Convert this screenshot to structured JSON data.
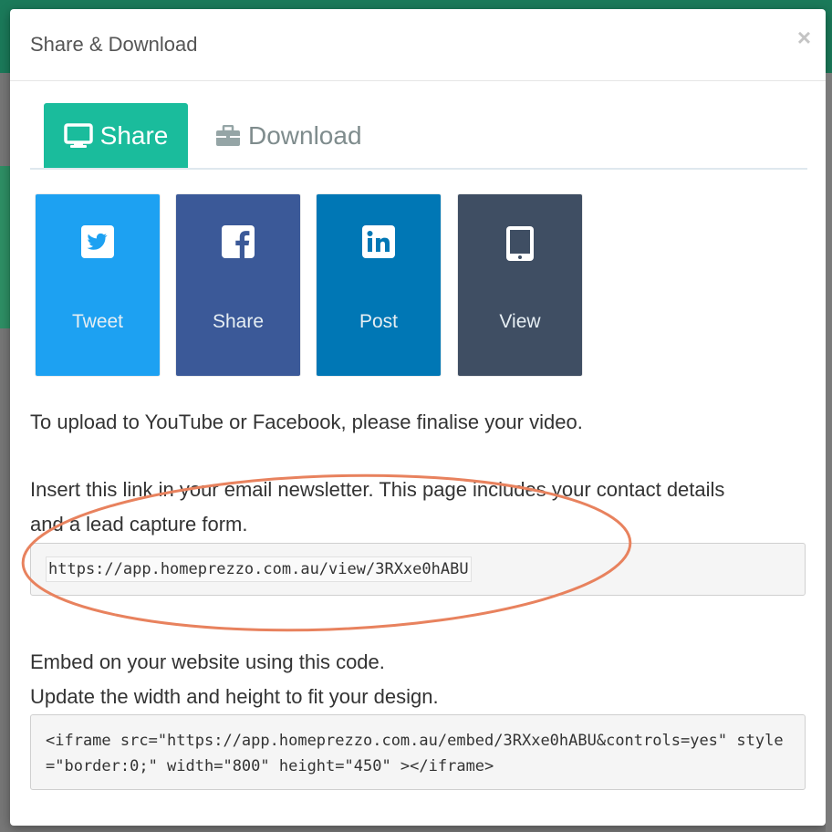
{
  "modal": {
    "title": "Share & Download",
    "close": "×"
  },
  "tabs": [
    {
      "label": "Share",
      "icon": "monitor-icon",
      "active": true
    },
    {
      "label": "Download",
      "icon": "briefcase-icon",
      "active": false
    }
  ],
  "share_buttons": [
    {
      "label": "Tweet",
      "icon": "twitter-icon",
      "color": "#1da1f2"
    },
    {
      "label": "Share",
      "icon": "facebook-icon",
      "color": "#3b5998"
    },
    {
      "label": "Post",
      "icon": "linkedin-icon",
      "color": "#0077b5"
    },
    {
      "label": "View",
      "icon": "tablet-icon",
      "color": "#3f4e63"
    }
  ],
  "text": {
    "youtube_note": "To upload to YouTube or Facebook, please finalise your video.",
    "link_intro_line1": "Insert this link in your email newsletter. This page includes your contact details",
    "link_intro_line2": "and a lead capture form.",
    "link_url": "https://app.homeprezzo.com.au/view/3RXxe0hABU",
    "embed_intro_line1": "Embed on your website using this code.",
    "embed_intro_line2": "Update the width and height to fit your design.",
    "embed_code": "<iframe src=\"https://app.homeprezzo.com.au/embed/3RXxe0hABU&controls=yes\" style=\"border:0;\" width=\"800\" height=\"450\" ></iframe>"
  },
  "colors": {
    "active_tab": "#1abc9c",
    "annotation": "#e8825e"
  }
}
